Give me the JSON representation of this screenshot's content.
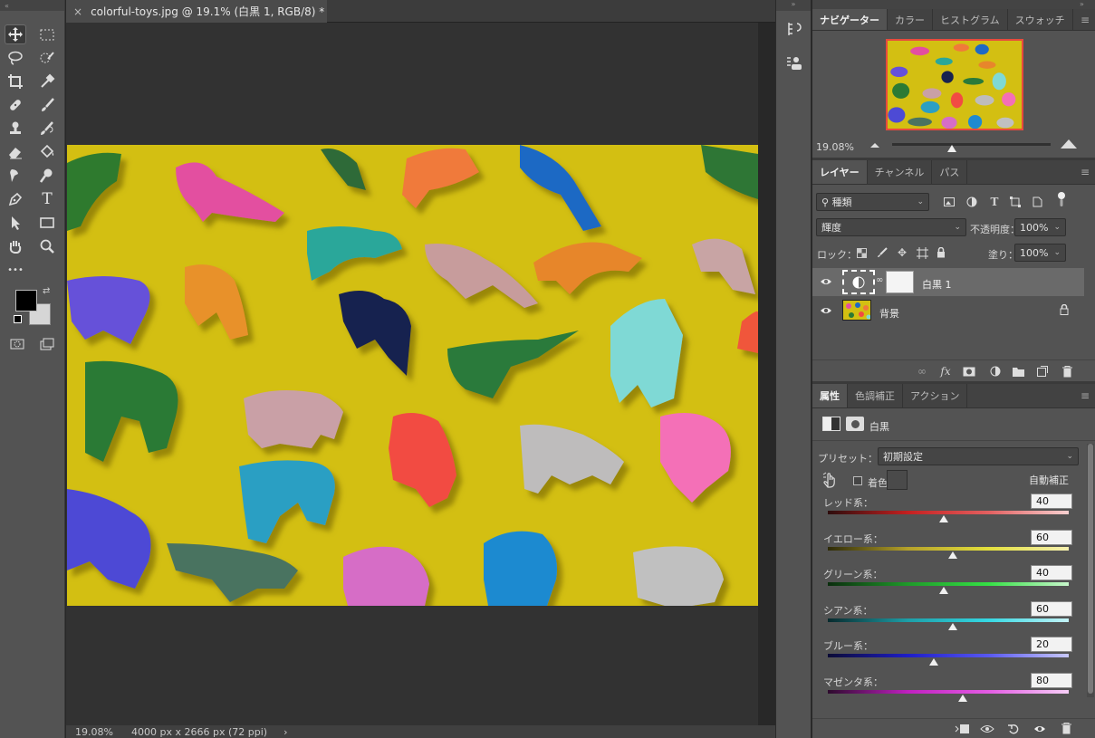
{
  "document": {
    "tab_title": "colorful-toys.jpg @ 19.1% (白黒 1, RGB/8) *",
    "zoom": "19.08%",
    "dimensions": "4000 px x 2666 px (72 ppi)",
    "status_arrow": "›"
  },
  "toolbar": {
    "tools": [
      "move-icon",
      "marquee-icon",
      "lasso-icon",
      "quick-select-icon",
      "crop-icon",
      "eyedropper-icon",
      "healing-icon",
      "brush-icon",
      "stamp-icon",
      "history-brush-icon",
      "eraser-icon",
      "paint-bucket-icon",
      "smudge-icon",
      "dodge-icon",
      "pen-icon",
      "type-icon",
      "path-select-icon",
      "rectangle-icon",
      "hand-icon",
      "zoom-icon",
      "more-icon"
    ],
    "more_label": "•••",
    "type_glyph": "T"
  },
  "navigator_panel": {
    "tabs": [
      "ナビゲーター",
      "カラー",
      "ヒストグラム",
      "スウォッチ"
    ],
    "zoom_value": "19.08%"
  },
  "layers_panel": {
    "tabs": [
      "レイヤー",
      "チャンネル",
      "パス"
    ],
    "filter_label": "種類",
    "blend_mode": "輝度",
    "opacity_label": "不透明度：",
    "opacity_value": "100%",
    "lock_label": "ロック：",
    "fill_label": "塗り：",
    "fill_value": "100%",
    "layers": [
      {
        "name": "白黒 1",
        "selected": true
      },
      {
        "name": "背景",
        "selected": false
      }
    ]
  },
  "properties_panel": {
    "tabs": [
      "属性",
      "色調補正",
      "アクション"
    ],
    "adjustment_name": "白黒",
    "preset_label": "プリセット：",
    "preset_value": "初期設定",
    "tint_label": "着色",
    "auto_label": "自動補正",
    "sliders": [
      {
        "label": "レッド系：",
        "value": "40",
        "pos": 0.48,
        "gradient": [
          "#2d0d0d",
          "#c42020",
          "#e26060",
          "#f7d0d0"
        ]
      },
      {
        "label": "イエロー系：",
        "value": "60",
        "pos": 0.52,
        "gradient": [
          "#2d2a08",
          "#b5a12a",
          "#e3df3c",
          "#f5f0b0"
        ]
      },
      {
        "label": "グリーン系：",
        "value": "40",
        "pos": 0.48,
        "gradient": [
          "#0a2d0d",
          "#1f9a2a",
          "#35e045",
          "#c8f7cc"
        ]
      },
      {
        "label": "シアン系：",
        "value": "60",
        "pos": 0.52,
        "gradient": [
          "#082a2d",
          "#1d9fa8",
          "#35d8e3",
          "#c4f3f6"
        ]
      },
      {
        "label": "ブルー系：",
        "value": "20",
        "pos": 0.44,
        "gradient": [
          "#0b0b35",
          "#1e1ec8",
          "#5858f0",
          "#c8c8fb"
        ]
      },
      {
        "label": "マゼンタ系：",
        "value": "80",
        "pos": 0.56,
        "gradient": [
          "#2d0b2d",
          "#c020c0",
          "#e35ce3",
          "#f8cff8"
        ]
      }
    ]
  }
}
